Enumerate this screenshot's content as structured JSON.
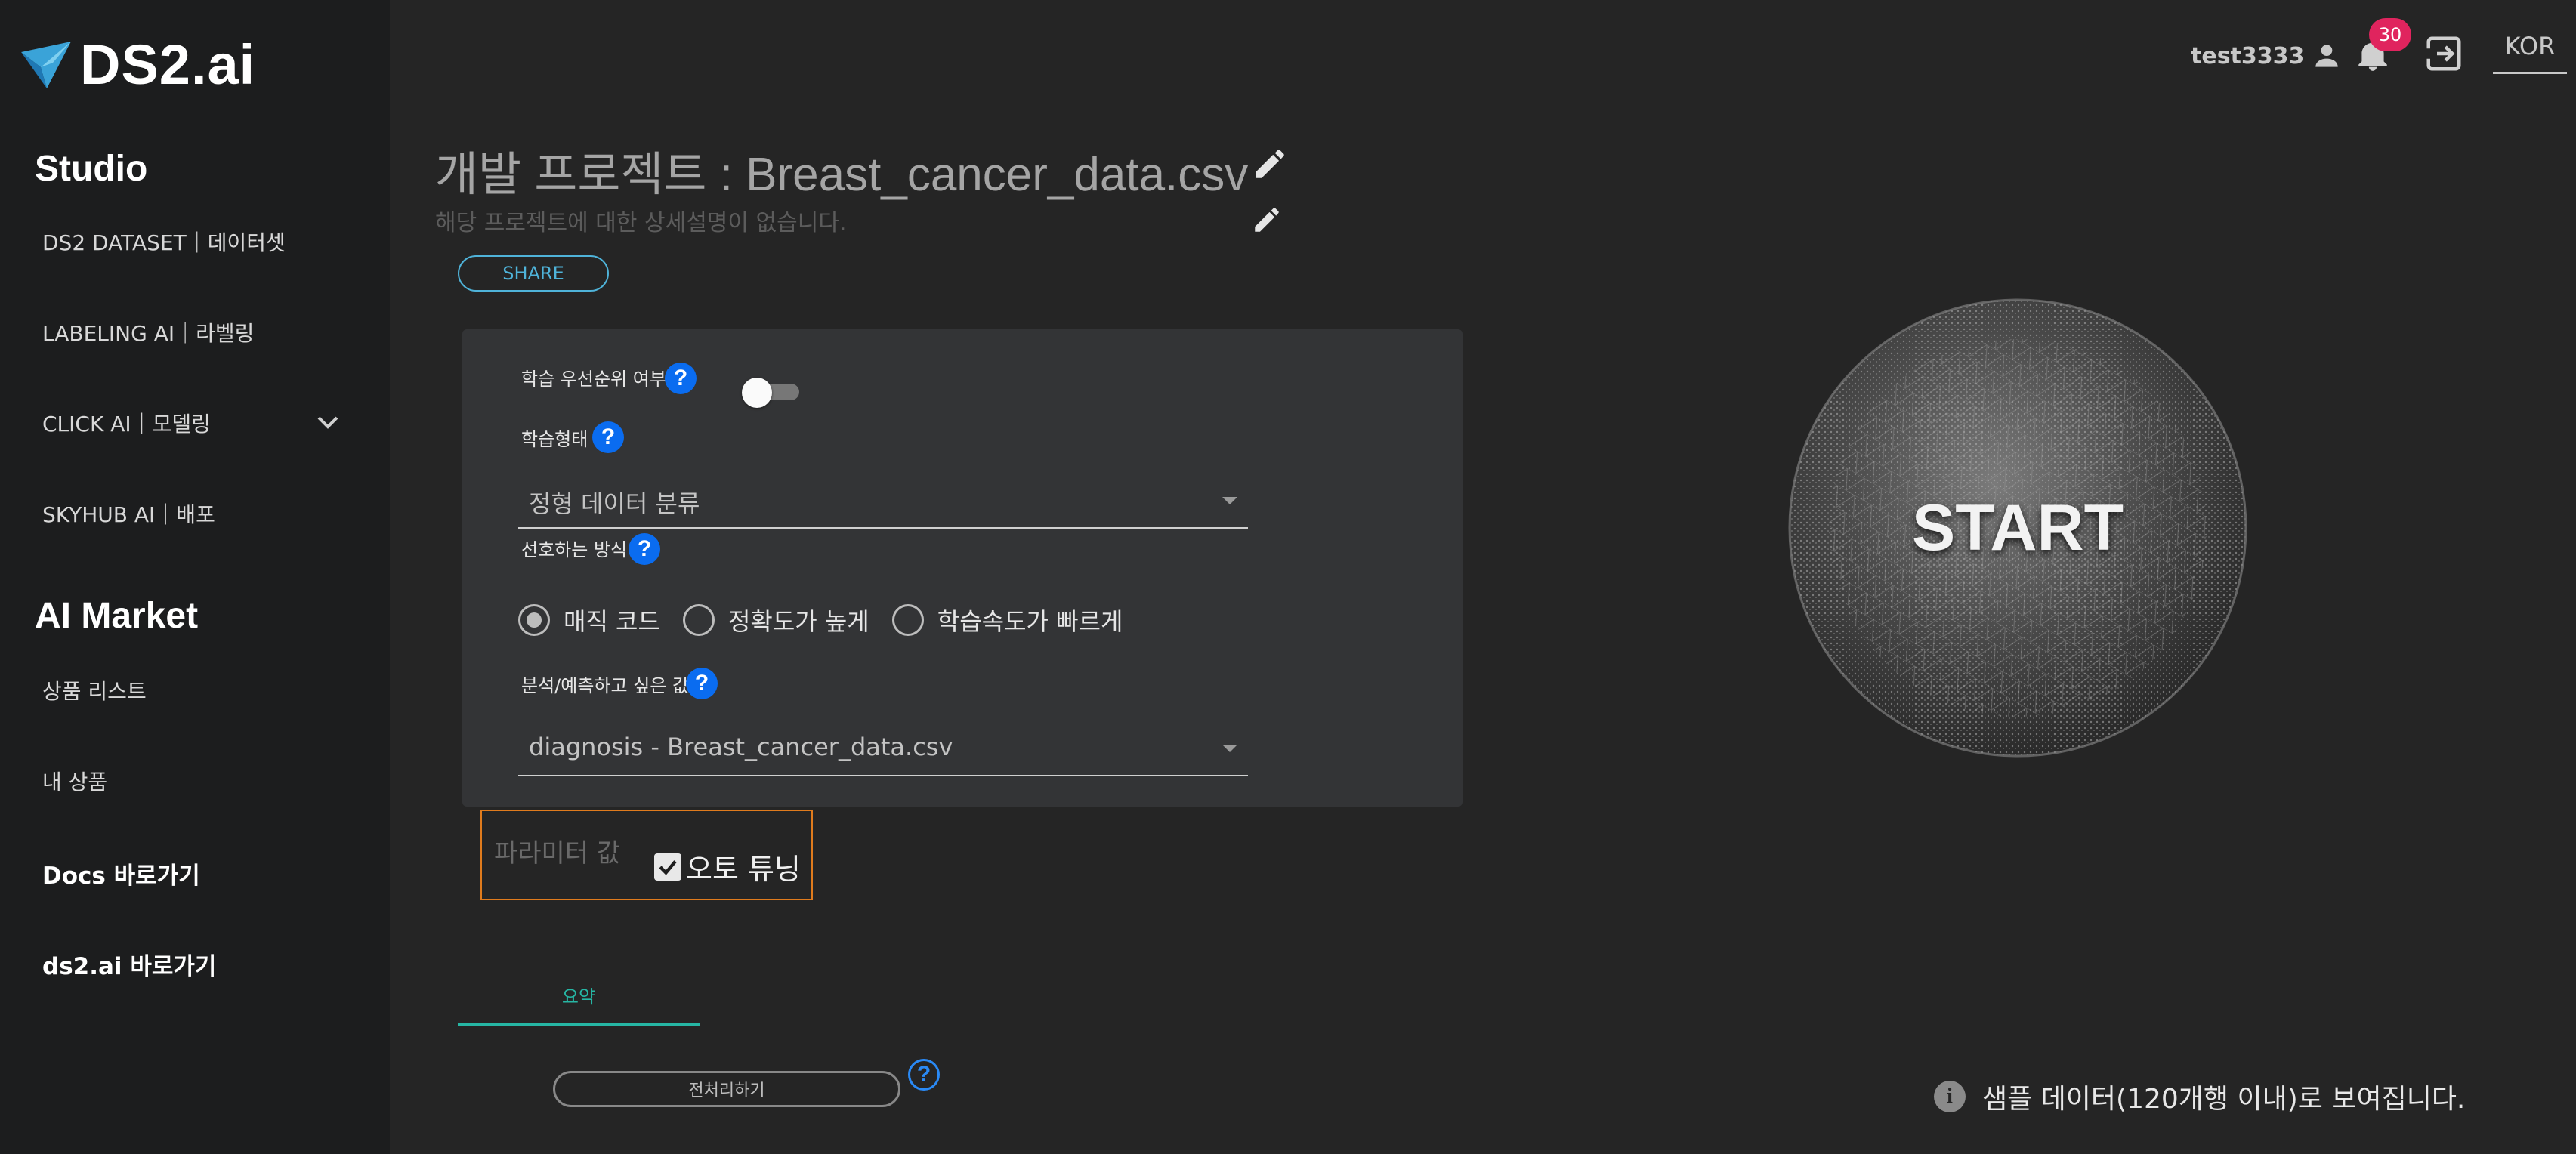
{
  "brand": {
    "name": "DS2.ai"
  },
  "sidebar": {
    "studio_heading": "Studio",
    "items": [
      {
        "label": "DS2 DATASET｜데이터셋"
      },
      {
        "label": "LABELING AI｜라벨링"
      },
      {
        "label": "CLICK AI｜모델링"
      },
      {
        "label": "SKYHUB AI｜배포"
      }
    ],
    "market_heading": "AI Market",
    "market_items": [
      {
        "label": "상품 리스트"
      },
      {
        "label": "내 상품"
      }
    ],
    "links": [
      {
        "label": "Docs 바로가기"
      },
      {
        "label": "ds2.ai 바로가기"
      }
    ]
  },
  "topbar": {
    "username": "test3333",
    "notification_count": "30",
    "language": "KOR"
  },
  "project": {
    "title": "개발 프로젝트 : Breast_cancer_data.csv",
    "description": "해당 프로젝트에 대한 상세설명이 없습니다.",
    "share_label": "SHARE"
  },
  "form": {
    "priority_label": "학습 우선순위 여부",
    "priority_on": false,
    "train_type_label": "학습형태",
    "train_type_value": "정형 데이터 분류",
    "method_label": "선호하는 방식",
    "methods": [
      {
        "label": "매직 코드",
        "selected": true
      },
      {
        "label": "정확도가 높게",
        "selected": false
      },
      {
        "label": "학습속도가 빠르게",
        "selected": false
      }
    ],
    "target_label": "분석/예측하고 싶은 값",
    "target_value": "diagnosis - Breast_cancer_data.csv",
    "help_glyph": "?"
  },
  "params": {
    "placeholder": "파라미터 값",
    "autotune_label": "오토 튜닝",
    "autotune_checked": true
  },
  "tabs": {
    "summary": "요약"
  },
  "preprocess": {
    "label": "전처리하기"
  },
  "start": {
    "label": "START"
  },
  "info": {
    "icon_glyph": "i",
    "text": "샘플 데이터(120개행 이내)로 보여집니다."
  },
  "colors": {
    "accent_teal": "#26b6a4",
    "share_blue": "#4fb3d9",
    "help_blue": "#0a6cf0",
    "badge_red": "#e0245e",
    "param_border": "#e07b1d"
  }
}
